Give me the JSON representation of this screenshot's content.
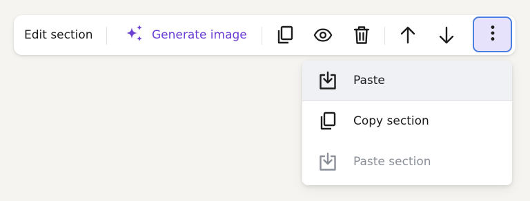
{
  "toolbar": {
    "edit_label": "Edit section",
    "generate_label": "Generate image",
    "icons": [
      "sparkles-icon",
      "copy-icon",
      "eye-icon",
      "trash-icon",
      "arrow-up-icon",
      "arrow-down-icon",
      "more-vertical-icon"
    ]
  },
  "menu": {
    "items": [
      {
        "label": "Paste",
        "icon": "paste-icon",
        "state": "hover",
        "color": "#1c1c1c"
      },
      {
        "label": "Copy section",
        "icon": "copy-icon",
        "state": "normal",
        "color": "#1c1c1c"
      },
      {
        "label": "Paste section",
        "icon": "paste-icon",
        "state": "disabled",
        "color": "#8a8f98"
      }
    ]
  },
  "colors": {
    "accent": "#6b3fd4",
    "focus_ring": "#4a7fe0",
    "active_bg": "#e6e2fb",
    "disabled_text": "#8a8f98"
  }
}
